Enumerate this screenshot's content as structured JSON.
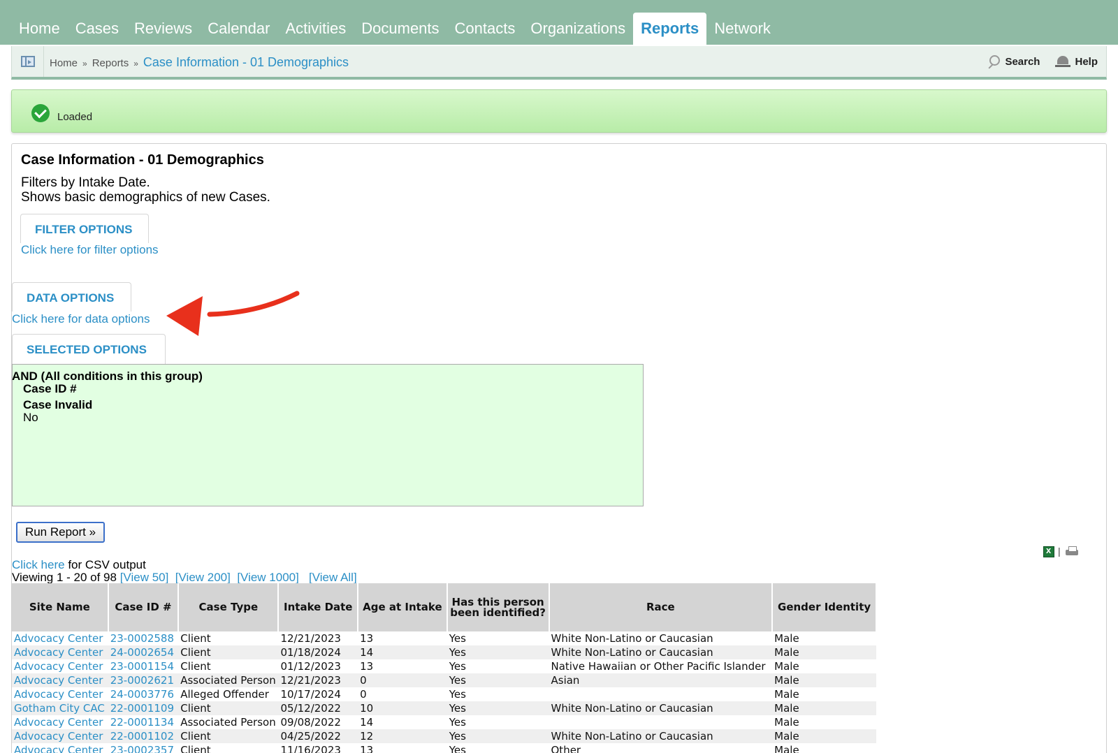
{
  "nav": {
    "tabs": [
      "Home",
      "Cases",
      "Reviews",
      "Calendar",
      "Activities",
      "Documents",
      "Contacts",
      "Organizations",
      "Reports",
      "Network"
    ],
    "active": "Reports"
  },
  "breadcrumb": {
    "home": "Home",
    "sep": "»",
    "reports": "Reports",
    "current": "Case Information - 01 Demographics"
  },
  "utility": {
    "search": "Search",
    "help": "Help"
  },
  "status": {
    "message": "Loaded"
  },
  "report": {
    "title": "Case Information - 01 Demographics",
    "desc_line1": "Filters by Intake Date.",
    "desc_line2": "Shows basic demographics of new Cases."
  },
  "filter_options": {
    "heading": "FILTER OPTIONS",
    "link": "Click here for filter options"
  },
  "data_options": {
    "heading": "DATA OPTIONS",
    "link": "Click here for data options"
  },
  "selected_options": {
    "heading": "SELECTED OPTIONS",
    "group": "AND (All conditions in this group)",
    "cond1_label": "Case ID #",
    "cond2_label": "Case Invalid",
    "cond2_value": "No"
  },
  "run_button": "Run Report »",
  "csv": {
    "link": "Click here",
    "text": " for CSV output"
  },
  "viewing": {
    "text": "Viewing 1 - 20 of 98",
    "view50": "[View 50]",
    "view200": "[View 200]",
    "view1000": "[View 1000]",
    "viewall": "[View All]"
  },
  "table": {
    "headers": [
      "Site Name",
      "Case ID #",
      "Case Type",
      "Intake Date",
      "Age at Intake",
      "Has this person been identified?",
      "Race",
      "Gender Identity"
    ],
    "rows": [
      [
        "Advocacy Center",
        "23-0002588",
        "Client",
        "12/21/2023",
        "13",
        "Yes",
        "White Non-Latino or Caucasian",
        "Male"
      ],
      [
        "Advocacy Center",
        "24-0002654",
        "Client",
        "01/18/2024",
        "14",
        "Yes",
        "White Non-Latino or Caucasian",
        "Male"
      ],
      [
        "Advocacy Center",
        "23-0001154",
        "Client",
        "01/12/2023",
        "13",
        "Yes",
        "Native Hawaiian or Other Pacific Islander",
        "Male"
      ],
      [
        "Advocacy Center",
        "23-0002621",
        "Associated Person",
        "12/21/2023",
        "0",
        "Yes",
        "Asian",
        "Male"
      ],
      [
        "Advocacy Center",
        "24-0003776",
        "Alleged Offender",
        "10/17/2024",
        "0",
        "Yes",
        "",
        "Male"
      ],
      [
        "Gotham City CAC",
        "22-0001109",
        "Client",
        "05/12/2022",
        "10",
        "Yes",
        "White Non-Latino or Caucasian",
        "Male"
      ],
      [
        "Advocacy Center",
        "22-0001134",
        "Associated Person",
        "09/08/2022",
        "14",
        "Yes",
        "",
        "Male"
      ],
      [
        "Advocacy Center",
        "22-0001102",
        "Client",
        "04/25/2022",
        "12",
        "Yes",
        "White Non-Latino or Caucasian",
        "Male"
      ],
      [
        "Advocacy Center",
        "23-0002357",
        "Client",
        "11/16/2023",
        "13",
        "Yes",
        "Other",
        "Male"
      ]
    ]
  },
  "colors": {
    "nav_bg": "#8fbaa4",
    "link": "#2b8fc6",
    "banner": "#c6f2b8",
    "cond_bg": "#e2ffe2",
    "arrow": "#e8301c"
  }
}
